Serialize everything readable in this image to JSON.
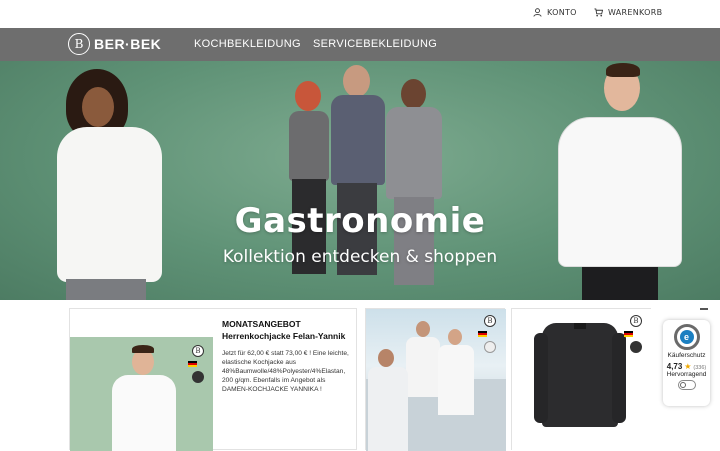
{
  "topbar": {
    "account_label": "KONTO",
    "cart_label": "WARENKORB"
  },
  "nav": {
    "logo_text": "BER·BEK",
    "logo_mark": "B",
    "links": [
      "KOCHBEKLEIDUNG",
      "SERVICEBEKLEIDUNG"
    ]
  },
  "hero": {
    "title": "Gastronomie",
    "subtitle": "Kollektion entdecken & shoppen",
    "background": "#5f9276"
  },
  "offer": {
    "label": "MONATSANGEBOT",
    "product": "Herrenkochjacke Felan-Yannik",
    "description": "Jetzt für 62,00 € statt 73,00 € ! Eine leichte, elastische Kochjacke aus 48%Baumwolle/48%Polyester/4%Elastan, 200 g/qm. Ebenfalls im Angebot als DAMEN-KOCHJACKE YANNIKA !"
  },
  "trust": {
    "label": "Käuferschutz",
    "score": "4,73",
    "count": "(336)",
    "grade": "Hervorragend",
    "seal_letter": "e"
  },
  "icons": {
    "account": "user-icon",
    "cart": "cart-icon",
    "star": "star-icon"
  }
}
